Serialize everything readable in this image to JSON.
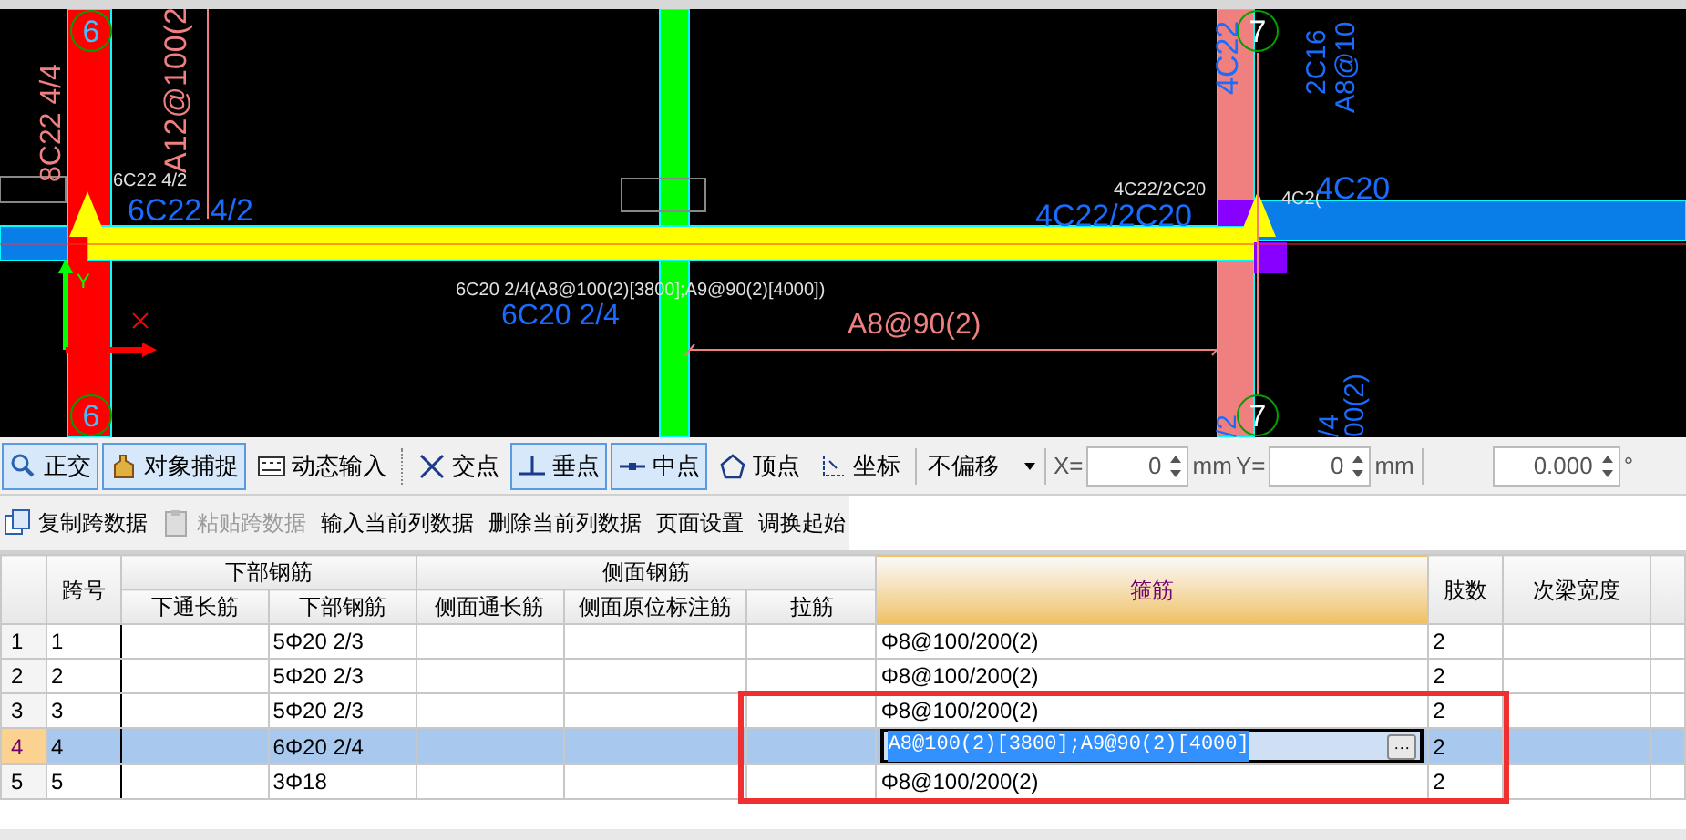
{
  "canvas": {
    "axis_bubbles": [
      "6",
      "7",
      "6",
      "7"
    ],
    "ucs_label": "Y",
    "labels": [
      "8C22 4/4",
      "A12@100(2",
      "4C22",
      "2C16",
      "A8@10",
      "6C22 4/2",
      "6C22 4/2",
      "4C22/2C20",
      "4C22/2C20",
      "4C2(",
      "4C20",
      "6C20 2/4(A8@100(2)[3800];A9@90(2)[4000])",
      "6C20 2/4",
      "A8@90(2)",
      "/2",
      "/4",
      "00(2)"
    ]
  },
  "snap_toolbar": {
    "items": [
      {
        "kind": "ortho",
        "label": "正交",
        "selected": true
      },
      {
        "kind": "snap",
        "label": "对象捕捉",
        "selected": true
      },
      {
        "kind": "dynamic",
        "label": "动态输入",
        "selected": false
      },
      {
        "kind": "intersection",
        "label": "交点",
        "selected": false
      },
      {
        "kind": "perpendicular",
        "label": "垂点",
        "selected": true
      },
      {
        "kind": "midpoint",
        "label": "中点",
        "selected": true
      },
      {
        "kind": "vertex",
        "label": "顶点",
        "selected": false
      },
      {
        "kind": "coordinate",
        "label": "坐标",
        "selected": false
      }
    ],
    "offset": "不偏移",
    "x_field": {
      "label": "X=",
      "value": "0",
      "unit": "mm"
    },
    "y_field": {
      "label": "Y=",
      "value": "0",
      "unit": "mm"
    },
    "angle_field": {
      "value": "0.000",
      "unit": "°"
    }
  },
  "action_toolbar": [
    {
      "kind": "copy",
      "label": "复制跨数据",
      "disabled": false
    },
    {
      "kind": "paste",
      "label": "粘贴跨数据",
      "disabled": true
    },
    {
      "kind": "text",
      "label": "输入当前列数据",
      "disabled": false
    },
    {
      "kind": "text",
      "label": "删除当前列数据",
      "disabled": false
    },
    {
      "kind": "text",
      "label": "页面设置",
      "disabled": false
    },
    {
      "kind": "text",
      "label": "调换起始",
      "disabled": false
    }
  ],
  "table": {
    "column_groups": [
      "下部钢筋",
      "侧面钢筋"
    ],
    "columns": [
      {
        "label": "跨号",
        "selected": false
      },
      {
        "label": "下通长筋",
        "selected": false
      },
      {
        "label": "下部钢筋",
        "selected": false
      },
      {
        "label": "侧面通长筋",
        "selected": false
      },
      {
        "label": "侧面原位标注筋",
        "selected": false
      },
      {
        "label": "拉筋",
        "selected": false
      },
      {
        "label": "箍筋",
        "selected": true
      },
      {
        "label": "肢数",
        "selected": false
      },
      {
        "label": "次梁宽度",
        "selected": false
      }
    ],
    "rows": [
      {
        "index": "1",
        "selected": false,
        "editing": false,
        "cells": [
          "1",
          "",
          "5Φ20 2/3",
          "",
          "",
          "",
          "Φ8@100/200(2)",
          "2",
          ""
        ]
      },
      {
        "index": "2",
        "selected": false,
        "editing": false,
        "cells": [
          "2",
          "",
          "5Φ20 2/3",
          "",
          "",
          "",
          "Φ8@100/200(2)",
          "2",
          ""
        ]
      },
      {
        "index": "3",
        "selected": false,
        "editing": false,
        "cells": [
          "3",
          "",
          "5Φ20 2/3",
          "",
          "",
          "",
          "Φ8@100/200(2)",
          "2",
          ""
        ]
      },
      {
        "index": "4",
        "selected": true,
        "editing": true,
        "cells": [
          "4",
          "",
          "6Φ20 2/4",
          "",
          "",
          "",
          "A8@100(2)[3800];A9@90(2)[4000]",
          "2",
          ""
        ]
      },
      {
        "index": "5",
        "selected": false,
        "editing": false,
        "cells": [
          "5",
          "",
          "3Φ18",
          "",
          "",
          "",
          "Φ8@100/200(2)",
          "2",
          ""
        ]
      }
    ],
    "edit_button": "···"
  }
}
